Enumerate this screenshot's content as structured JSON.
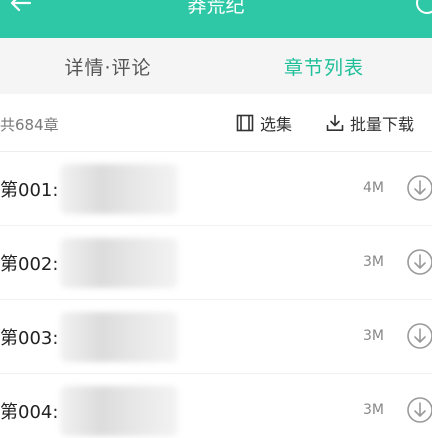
{
  "header": {
    "title": "莽荒纪",
    "back_icon": "arrow-left-icon",
    "right_icon": "circle-icon",
    "bg_color": "#2ec8a6"
  },
  "tabs": [
    {
      "label": "详情·评论",
      "active": false
    },
    {
      "label": "章节列表",
      "active": true
    }
  ],
  "subbar": {
    "count_label": "共684章",
    "select_label": "选集",
    "select_icon": "list-select-icon",
    "batch_label": "批量下载",
    "batch_icon": "download-tray-icon"
  },
  "chapters": [
    {
      "title": "第001:",
      "size": "4M",
      "icon": "download-circle-icon"
    },
    {
      "title": "第002:",
      "size": "3M",
      "icon": "download-circle-icon"
    },
    {
      "title": "第003:",
      "size": "3M",
      "icon": "download-circle-icon"
    },
    {
      "title": "第004:",
      "size": "3M",
      "icon": "download-circle-icon"
    }
  ],
  "colors": {
    "accent": "#1fbf9a",
    "tab_bg": "#f5f5f5"
  }
}
